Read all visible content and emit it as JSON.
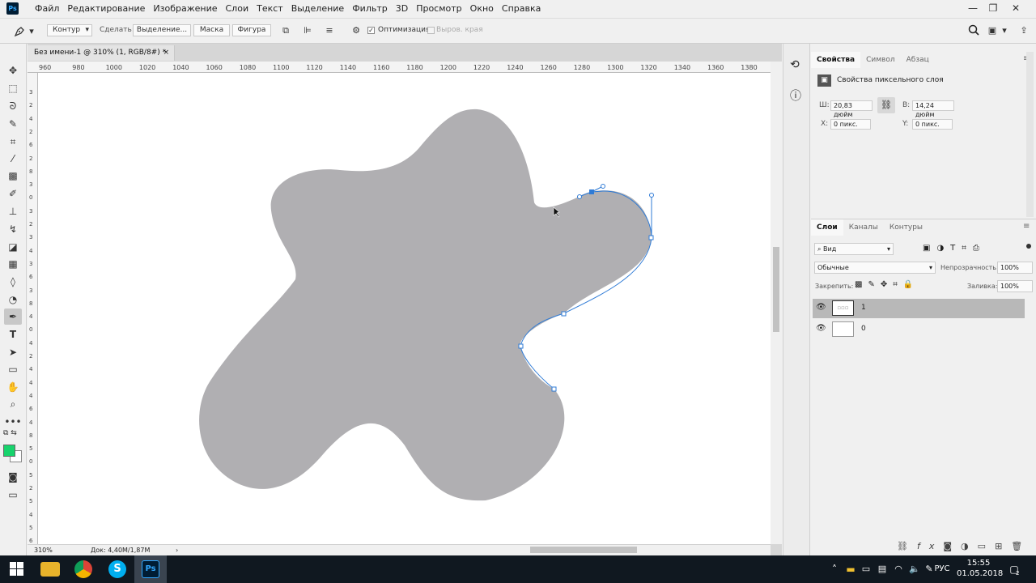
{
  "menu": [
    "Файл",
    "Редактирование",
    "Изображение",
    "Слои",
    "Текст",
    "Выделение",
    "Фильтр",
    "3D",
    "Просмотр",
    "Окно",
    "Справка"
  ],
  "app_logo": "Ps",
  "window_controls": {
    "minimize": "—",
    "restore": "❐",
    "close": "✕"
  },
  "options": {
    "tool_icon": "pen-icon",
    "mode_value": "Контур",
    "make_label": "Сделать:",
    "selection_btn": "Выделение...",
    "mask_btn": "Маска",
    "shape_btn": "Фигура",
    "optimization_label": "Оптимизация",
    "align_edges_label": "Выров. края"
  },
  "document": {
    "tab_title": "Без имени-1 @ 310% (1, RGB/8#) *",
    "close": "×",
    "ruler_top_ticks": [
      "960",
      "980",
      "1000",
      "1020",
      "1040",
      "1060",
      "1080",
      "1100",
      "1120",
      "1140",
      "1160",
      "1180",
      "1200",
      "1220",
      "1240",
      "1260",
      "1280",
      "1300",
      "1320",
      "1340",
      "1360",
      "1380"
    ],
    "ruler_left_ticks": [
      "3",
      "2",
      "4",
      "2",
      "6",
      "2",
      "8",
      "3",
      "0",
      "3",
      "2",
      "3",
      "4",
      "3",
      "6",
      "3",
      "8",
      "4",
      "0",
      "4",
      "2",
      "4",
      "4",
      "4",
      "6",
      "4",
      "8",
      "5",
      "0",
      "5",
      "2",
      "5",
      "4",
      "5",
      "6"
    ],
    "zoom": "310%",
    "doc_info": "Док: 4,40M/1,87M",
    "shape_fill": "#b0afb2",
    "path_color": "#2f7bd6"
  },
  "colors": {
    "foreground": "#17d36c",
    "background": "#ffffff"
  },
  "properties": {
    "tabs": [
      "Свойства",
      "Символ",
      "Абзац"
    ],
    "title": "Свойства пиксельного слоя",
    "w_label": "Ш:",
    "w_value": "20,83 дюйм",
    "h_label": "В:",
    "h_value": "14,24 дюйм",
    "x_label": "X:",
    "x_value": "0 пикс.",
    "y_label": "Y:",
    "y_value": "0 пикс."
  },
  "layers": {
    "tabs": [
      "Слои",
      "Каналы",
      "Контуры"
    ],
    "filter_label": "Вид",
    "blend_mode": "Обычные",
    "opacity_label": "Непрозрачность:",
    "opacity_value": "100%",
    "lock_label": "Закрепить:",
    "fill_label": "Заливка:",
    "fill_value": "100%",
    "items": [
      {
        "name": "1",
        "selected": true
      },
      {
        "name": "0",
        "selected": false
      }
    ],
    "bottom_icons": [
      "link-icon",
      "fx-icon",
      "mask-icon",
      "adjustment-icon",
      "folder-icon",
      "new-layer-icon",
      "trash-icon"
    ]
  },
  "taskbar": {
    "language": "РУС",
    "time": "15:55",
    "date": "01.05.2018",
    "notification_count": "2",
    "skype": "S",
    "photoshop": "Ps"
  }
}
